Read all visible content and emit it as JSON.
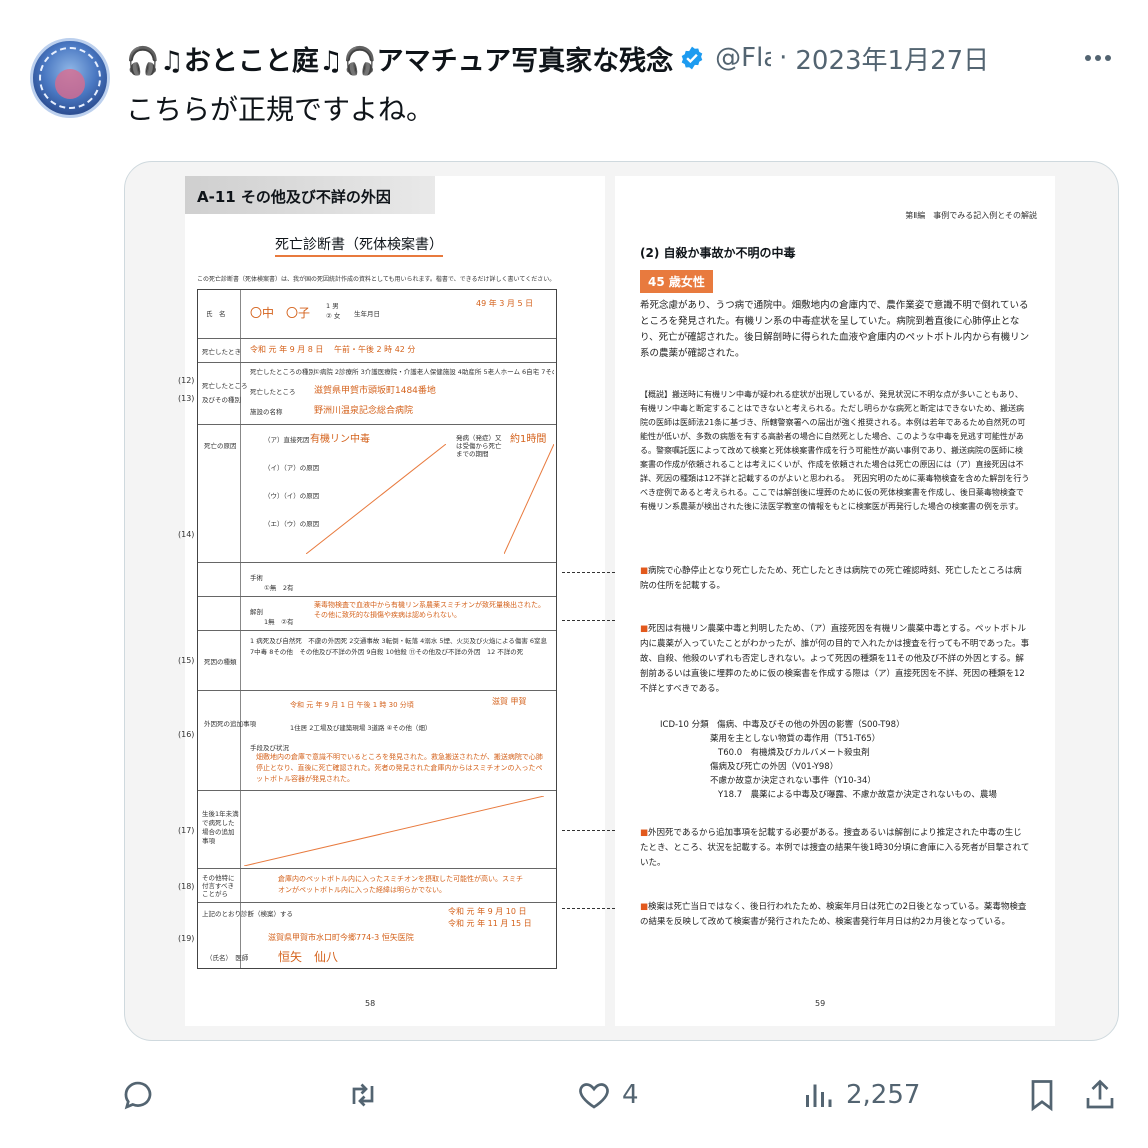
{
  "tweet": {
    "display_name": "🎧♫おとこと庭♫🎧アマチュア写真家な残念",
    "handle": "@Fla",
    "separator": "·",
    "date": "2023年1月27日",
    "text": "こちらが正規ですよね。"
  },
  "media": {
    "left_page": {
      "section": "A-11 その他及び不詳の外因",
      "form_title": "死亡診断書（死体検案書）",
      "note": "この死亡診断書（死体検案書）は、我が国の死因統計作成の資料としても用いられます。楷書で、できるだけ詳しく書いてください。",
      "name_label": "氏　名",
      "name_value": "〇中　〇子",
      "sex_options": "1 男　② 女",
      "birth_label": "生年月日",
      "birth_value": "49 年 3 月 5 日",
      "death_time_label": "死亡したとき",
      "death_time_value": "令和 元 年 9 月 8 日 　午前・午後 2 時 42 分",
      "place_label_a": "死亡したところ",
      "place_label_b": "及びその種別",
      "place_kind_label": "死亡したところの種別",
      "place_kind_options": "①病院 2診療所 3介護医療院・介護老人保健施設 4助産所 5老人ホーム 6自宅 7その他",
      "place_address_label": "死亡したところ",
      "place_address": "滋賀県甲賀市頭坂町1484番地",
      "facility_label": "施設の名称",
      "facility_name": "野洲川温泉記念総合病院",
      "cause_label": "死亡の原因",
      "cause_rows": [
        "（ア）直接死因",
        "（イ）（ア）の原因",
        "（ウ）（イ）の原因",
        "（エ）（ウ）の原因"
      ],
      "cause_a_value": "有機リン中毒",
      "onset_label": "発病（発症）又は受傷から死亡までの期間",
      "onset_value": "約1時間",
      "surgery_label": "手術",
      "surgery_options": "①無　2有",
      "autopsy_label": "解剖",
      "autopsy_options": "1無　②有",
      "autopsy_finding": "薬毒物検査で血液中から有機リン系農薬スミチオンが致死量検出された。その他に致死的な損傷や疾病は認められない。",
      "kind_label": "死因の種類",
      "kind_text": "1 病死及び自然死　不慮の外因死 2交通事故 3転倒・転落 4溺水 5煙、火災及び火焔による傷害 6窒息 7中毒 8その他　その他及び不詳の外因 9自殺 10他殺 ⑪その他及び不詳の外因　12 不詳の死",
      "external_label": "外因死の追加事項",
      "external_time": "令和 元 年 9 月 1 日 午後 1 時 30 分頃",
      "external_place_value": "滋賀 甲賀",
      "external_place_kind": "1住居 2工場及び建築現場 3道路 ④その他（畑）",
      "situation_label": "手段及び状況",
      "situation_text": "畑敷地内の倉庫で意識不明でいるところを発見された。救急搬送されたが、搬送病院で心肺停止となり、直後に死亡確認された。死者の発見された倉庫内からはスミチオンの入ったペットボトル容器が発見された。",
      "infant_label": "生後1年未満で病死した場合の追加事項",
      "other_label": "その他特に付言すべきことがら",
      "other_text": "倉庫内のペットボトル内に入ったスミチオンを摂取した可能性が高い。スミチオンがペットボトル内に入った経緯は明らかでない。",
      "certify_label": "上記のとおり診断（検案）する",
      "certify_date_a": "令和 元 年 9 月 10 日",
      "certify_date_b": "令和 元 年 11 月 15 日",
      "hospital_address": "滋賀県甲賀市水口町今郷774-3 恒矢医院",
      "doctor_label": "（氏名）　医師",
      "doctor_name": "恒矢　仙八",
      "row_numbers": [
        "(12)",
        "(13)",
        "(14)",
        "(15)",
        "(16)",
        "(17)",
        "(18)",
        "(19)"
      ],
      "page_number": "58"
    },
    "right_page": {
      "header": "第Ⅱ編　事例でみる記入例とその解説",
      "subtitle": "(2) 自殺か事故か不明の中毒",
      "age_badge": "45 歳女性",
      "intro": "希死念慮があり、うつ病で通院中。畑敷地内の倉庫内で、農作業姿で意識不明で倒れているところを発見された。有機リン系の中毒症状を呈していた。病院到着直後に心肺停止となり、死亡が確認された。後日解剖時に得られた血液や倉庫内のペットボトル内から有機リン系の農薬が確認された。",
      "overview": "【概説】搬送時に有機リン中毒が疑われる症状が出現しているが、発見状況に不明な点が多いこともあり、有機リン中毒と断定することはできないと考えられる。ただし明らかな病死と断定はできないため、搬送病院の医師は医師法21条に基づき、所轄警察署への届出が強く推奨される。本例は若年であるため自然死の可能性が低いが、多数の病態を有する高齢者の場合に自然死とした場合、このような中毒を見逃す可能性がある。警察嘱託医によって改めて検案と死体検案書作成を行う可能性が高い事例であり、搬送病院の医師に検案書の作成が依頼されることは考えにくいが、作成を依頼された場合は死亡の原因には（ア）直接死因は不詳、死因の種類は12不詳と記載するのがよいと思われる。　死因究明のために薬毒物検査を含めた解剖を行うべき症例であると考えられる。ここでは解剖後に埋葬のために仮の死体検案書を作成し、後日薬毒物検査で有機リン系農薬が検出された後に法医学教室の情報をもとに検案医が再発行した場合の検案書の例を示す。",
      "note1": "病院で心静停止となり死亡したため、死亡したときは病院での死亡確認時刻、死亡したところは病院の住所を記載する。",
      "note2": "死因は有機リン農薬中毒と判明したため、（ア）直接死因を有機リン農薬中毒とする。ペットボトル内に農薬が入っていたことがわかったが、誰が何の目的で入れたかは捜査を行っても不明であった。事故、自殺、他殺のいずれも否定しきれない。よって死因の種類を11その他及び不詳の外因とする。解剖前あるいは直後に埋葬のために仮の検案書を作成する際は（ア）直接死因を不詳、死因の種類を12不詳とすべきである。",
      "icd_lines": [
        "ICD-10 分類　傷病、中毒及びその他の外因の影響（S00-T98）",
        "薬用を主としない物質の毒作用（T51-T65）",
        "T60.0　有機燐及びカルバメート殺虫剤",
        "傷病及び死亡の外因（V01-Y98）",
        "不慮か故意か決定されない事件（Y10-34）",
        "Y18.7　農薬による中毒及び曝露、不慮か故意か決定されないもの、農場"
      ],
      "note3": "外因死であるから追加事項を記載する必要がある。捜査あるいは解剖により推定された中毒の生じたとき、ところ、状況を記載する。本例では捜査の結果午後1時30分頃に倉庫に入る死者が目撃されていた。",
      "note4": "検案は死亡当日ではなく、後日行われたため、検案年月日は死亡の2日後となっている。薬毒物検査の結果を反映して改めて検案書が発行されたため、検案書発行年月日は約2カ月後となっている。",
      "page_number": "59"
    }
  },
  "actions": {
    "reply_count": "",
    "retweet_count": "",
    "like_count": "4",
    "views_count": "2,257"
  },
  "colors": {
    "accent": "#e87a3e",
    "verified": "#1d9bf0",
    "muted": "#536471"
  }
}
